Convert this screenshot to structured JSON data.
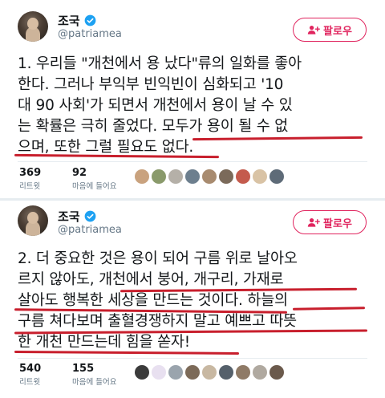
{
  "tweets": [
    {
      "display_name": "조국",
      "handle": "@patriamea",
      "follow_label": "팔로우",
      "text_lines": [
        "1. 우리들 \"개천에서 용 났다\"류의 일화를 좋아",
        "한다. 그러나 부익부 빈익빈이 심화되고 '10",
        "대 90 사회'가 되면서 개천에서 용이 날 수 있",
        "는 확률은 극히 줄었다. 모두가 용이 될 수 없",
        "으며, 또한 그럴 필요도 없다."
      ],
      "retweets": "369",
      "retweets_label": "리트윗",
      "likes": "92",
      "likes_label": "마음에 들어요",
      "liker_colors": [
        "#c9a27e",
        "#8a9a6b",
        "#b5b0a8",
        "#6d7f8e",
        "#a88b6f",
        "#7b6a5a",
        "#c45b4d",
        "#d9c3a5",
        "#5e6b78"
      ]
    },
    {
      "display_name": "조국",
      "handle": "@patriamea",
      "follow_label": "팔로우",
      "text_lines": [
        "2. 더 중요한 것은 용이 되어 구름 위로 날아오",
        "르지 않아도, 개천에서 붕어, 개구리, 가재로",
        "살아도 행복한 세상을 만드는 것이다. 하늘의",
        "구름 쳐다보며 출혈경쟁하지 말고 예쁘고 따뜻",
        "한 개천 만드는데 힘을 쏟자!"
      ],
      "retweets": "540",
      "retweets_label": "리트윗",
      "likes": "155",
      "likes_label": "마음에 들어요",
      "liker_colors": [
        "#3b3b3b",
        "#e8e0f0",
        "#9aa4ad",
        "#7c6a58",
        "#c8b8a2",
        "#55606b",
        "#8f7a66",
        "#b0a9a0",
        "#6b5a4c"
      ]
    }
  ],
  "colors": {
    "follow_accent": "#e0245e",
    "verified": "#1da1f2",
    "underline": "#c81f2d"
  }
}
